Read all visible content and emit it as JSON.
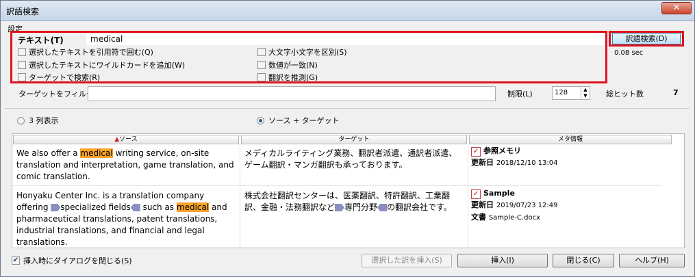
{
  "window": {
    "title": "訳語検索",
    "close_glyph": "✕"
  },
  "settings_label": "設定",
  "text_field": {
    "label": "テキスト(T)",
    "value": "medical"
  },
  "checkboxes": {
    "quote": "選択したテキストを引用符で囲む(Q)",
    "wildcard": "選択したテキストにワイルドカードを追加(W)",
    "target_search": "ターゲットで検索(R)",
    "case": "大文字小文字を区別(S)",
    "numbers": "数値が一致(N)",
    "guess": "翻訳を推測(G)"
  },
  "search_button": "訳語検索(D)",
  "elapsed": "0.08 sec",
  "filter": {
    "label": "ターゲットをフィルタ",
    "value": ""
  },
  "limit": {
    "label": "制限(L)",
    "value": "128"
  },
  "hits": {
    "label": "総ヒット数",
    "value": "7"
  },
  "view_modes": {
    "three_col": "3 列表示",
    "source_target": "ソース + ターゲット"
  },
  "columns": {
    "source": "ソース",
    "target": "ターゲット",
    "meta": "メタ情報"
  },
  "results": [
    {
      "source_pre": "We also offer a ",
      "source_hit": "medical",
      "source_post": " writing service, on-site translation and interpretation, game translation, and comic translation.",
      "target": "メディカルライティング業務、翻訳者派遣、通訳者派遣、ゲーム翻訳・マンガ翻訳も承っております。",
      "meta_name": "参照メモリ",
      "meta_updated_label": "更新日",
      "meta_updated": "2018/12/10 13:04"
    },
    {
      "source_a": "Honyaku Center Inc. is a translation company offering ",
      "source_b": "specialized fields",
      "source_c": " such as ",
      "source_hit": "medical",
      "source_d": " and pharmaceutical translations, patent translations, industrial translations, and financial and legal translations.",
      "target_a": "株式会社翻訳センターは、医薬翻訳、特許翻訳、工業翻訳、金融・法務翻訳など",
      "target_b": "専門分野",
      "target_c": "の翻訳会社です。",
      "meta_name": "Sample",
      "meta_updated_label": "更新日",
      "meta_updated": "2019/07/23 12:49",
      "meta_doc_label": "文書",
      "meta_doc": "Sample-C.docx"
    }
  ],
  "bottom": {
    "close_on_insert": "挿入時にダイアログを閉じる(S)",
    "insert_selected": "選択した訳を挿入(S)",
    "insert": "挿入(I)",
    "close": "閉じる(C)",
    "help": "ヘルプ(H)"
  }
}
